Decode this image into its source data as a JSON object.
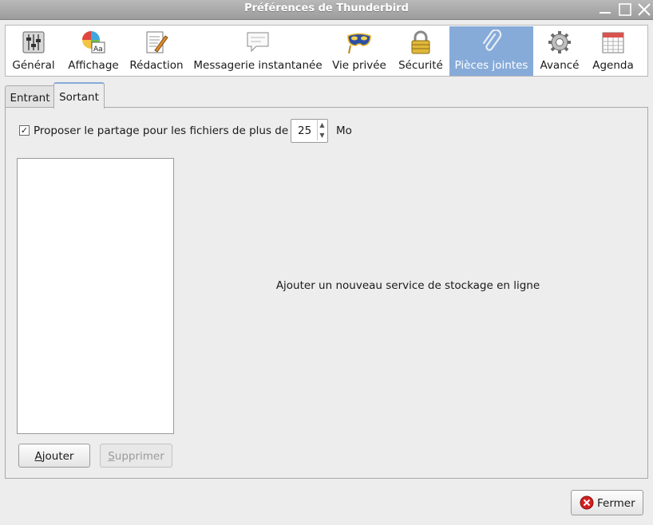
{
  "window": {
    "title": "Préférences de Thunderbird"
  },
  "panes": [
    {
      "label": "Général",
      "icon": "general-settings-icon"
    },
    {
      "label": "Affichage",
      "icon": "display-icon"
    },
    {
      "label": "Rédaction",
      "icon": "composition-icon"
    },
    {
      "label": "Messagerie instantanée",
      "icon": "chat-icon"
    },
    {
      "label": "Vie privée",
      "icon": "privacy-mask-icon"
    },
    {
      "label": "Sécurité",
      "icon": "padlock-icon"
    },
    {
      "label": "Pièces jointes",
      "icon": "paperclip-icon"
    },
    {
      "label": "Avancé",
      "icon": "gear-icon"
    },
    {
      "label": "Agenda",
      "icon": "calendar-icon"
    }
  ],
  "selected_pane": "Pièces jointes",
  "tabs": [
    {
      "label": "Entrant"
    },
    {
      "label": "Sortant"
    }
  ],
  "active_tab": "Sortant",
  "outgoing": {
    "offer_share_label": "Proposer le partage pour les fichiers de plus de",
    "offer_share_checked": true,
    "size_value": "25",
    "size_unit": "Mo",
    "empty_message": "Ajouter un nouveau service de stockage en ligne",
    "add_button_first": "A",
    "add_button_rest": "jouter",
    "remove_button_first": "S",
    "remove_button_rest": "upprimer"
  },
  "footer": {
    "close_label": "Fermer"
  },
  "colors": {
    "selection": "#86abd9",
    "close_icon": "#d21f1f"
  }
}
